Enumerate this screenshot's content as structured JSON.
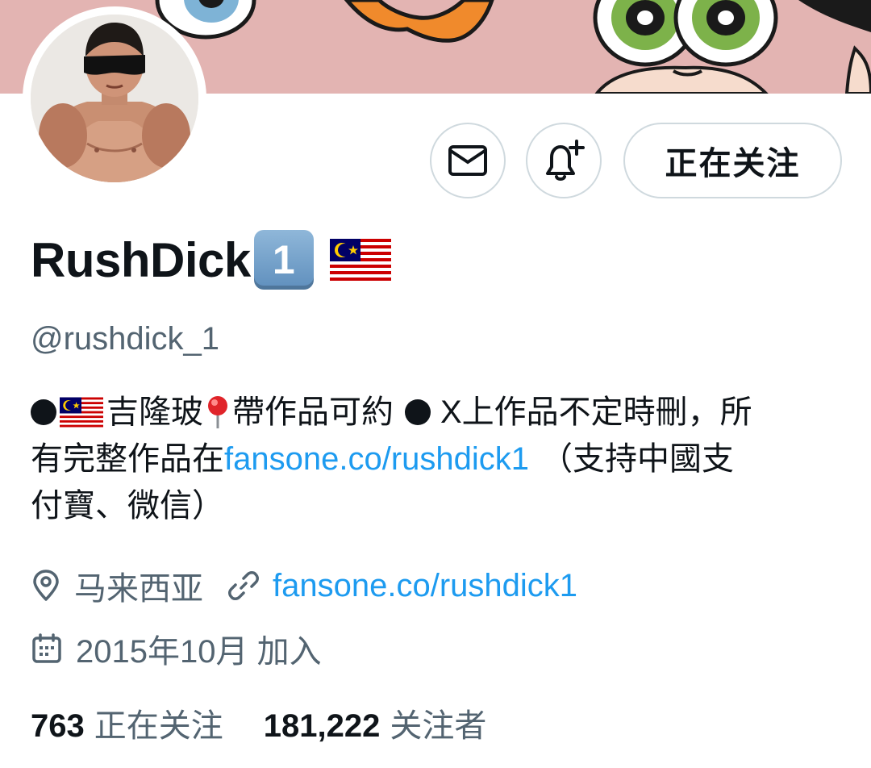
{
  "profile": {
    "display_name": "RushDick",
    "name_badge": "1",
    "handle": "@rushdick_1",
    "follow_button_label": "正在关注"
  },
  "bio": {
    "line1_text_a": "吉隆玻",
    "line1_text_b": "帶作品可約",
    "line1_text_c": "X上作品不定時刪，所",
    "line2_text_a": "有完整作品在",
    "line2_link": "fansone.co/rushdick1",
    "line2_text_b": "（支持中國支",
    "line3_text": "付寶、微信）"
  },
  "meta": {
    "location": "马来西亚",
    "website": "fansone.co/rushdick1",
    "joined": "2015年10月 加入"
  },
  "stats": {
    "following_count": "763",
    "following_label": "正在关注",
    "followers_count": "181,222",
    "followers_label": "关注者"
  },
  "icons": {
    "message": "envelope-icon",
    "notify": "bell-plus-icon",
    "location": "location-pin-icon",
    "link": "link-icon",
    "calendar": "calendar-icon",
    "flag": "malaysia-flag-icon"
  },
  "colors": {
    "link": "#1d9bf0",
    "secondary_text": "#536471",
    "primary_text": "#0f1419",
    "border": "#cfd9de",
    "banner_bg": "#e3b4b2"
  }
}
